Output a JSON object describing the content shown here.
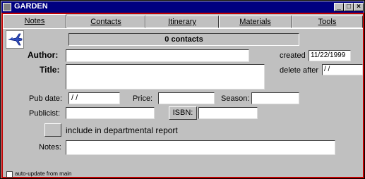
{
  "window": {
    "title": "GARDEN"
  },
  "titlebar_buttons": {
    "minimize": "_",
    "maximize": "□",
    "close": "×"
  },
  "tabs": [
    {
      "label": "Notes"
    },
    {
      "label": "Contacts"
    },
    {
      "label": "Itinerary"
    },
    {
      "label": "Materials"
    },
    {
      "label": "Tools"
    }
  ],
  "contacts_count": "0 contacts",
  "labels": {
    "author": "Author:",
    "title": "Title:",
    "created": "created",
    "delete_after": "delete after",
    "pub_date": "Pub date:",
    "price": "Price:",
    "season": "Season:",
    "publicist": "Publicist:",
    "isbn": "ISBN:",
    "include_report": "include in departmental report",
    "notes": "Notes:",
    "auto_update": "auto-update from main"
  },
  "values": {
    "author": "",
    "title": "",
    "created": "11/22/1999",
    "delete_after": " / /",
    "pub_date": " / /",
    "price": "",
    "season": "",
    "publicist": "",
    "isbn": "",
    "notes": ""
  }
}
